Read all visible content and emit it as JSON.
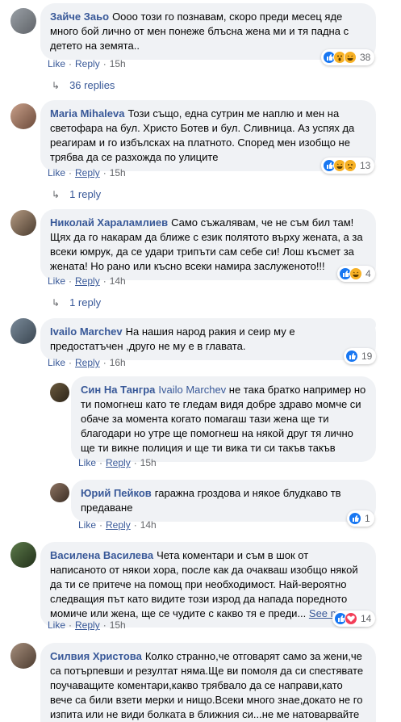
{
  "labels": {
    "like": "Like",
    "reply": "Reply",
    "see_more": "See more"
  },
  "colors": {
    "link": "#385898",
    "bubble": "#f0f2f5",
    "meta": "#65676b",
    "like": "#1877f2",
    "haha": "#f7b125",
    "love": "#f33e58"
  },
  "comments": [
    {
      "author": "Зайче Заьо",
      "text": "Оооо този го познавам, скоро преди месец яде много бой лично от мен понеже блъсна жена ми и тя падна с детето на земята..",
      "time": "15h",
      "reactions": [
        "like",
        "wow",
        "haha"
      ],
      "reaction_count": "38",
      "replies_label": "36 replies"
    },
    {
      "author": "Maria Mihaleva",
      "text": "Този също, една сутрин ме наплю и мен на светофара на бул. Христо Ботев и бул. Сливница. Аз успях да реагирам и го избълсках на платното. Според мен изобщо не трябва да се разхожда по улиците",
      "time": "15h",
      "reactions": [
        "like",
        "haha",
        "sad"
      ],
      "reaction_count": "13",
      "replies_label": "1 reply"
    },
    {
      "author": "Николай Хараламлиев",
      "text": "Само съжалявам, че не съм бил там! Щях да го накарам да ближе с език полятото върху жената, а за всеки юмрук, да се удари трипъти сам себе си! Лош късмет за жената! Но рано или късно всеки намира заслуженото!!!",
      "time": "14h",
      "reactions": [
        "like",
        "haha"
      ],
      "reaction_count": "4",
      "replies_label": "1 reply"
    },
    {
      "author": "Ivailo Marchev",
      "text": "На нашия народ ракия и сеир му е предостатъчен ,друго не му е в главата.",
      "time": "16h",
      "reactions": [
        "like"
      ],
      "reaction_count": "19"
    },
    {
      "author": "Син На Тангра",
      "mention": "Ivailo Marchev",
      "text": "не така братко например но ти помогнеш като те гледам видя добре здраво момче си обаче за момента когато помагаш тази жена ще ти благодари но утре ще помогнеш на някой друг тя лично ще ти викне полиция и ще ти вика ти си такъв такъв",
      "time": "15h"
    },
    {
      "author": "Юрий Пейков",
      "text": "гаражна гроздова и някое блудкаво тв предаване",
      "time": "14h",
      "reactions": [
        "like"
      ],
      "reaction_count": "1"
    },
    {
      "author": "Василена Василева",
      "text": "Чета коментари и съм в шок от написаното от някои хора, после как да очакваш изобщо някой да ти се притече на помощ при необходимост. Най-вероятно следващия път като видите този изрод да напада поредното момиче или жена, ще се чудите с какво тя е преди...",
      "time": "15h",
      "reactions": [
        "like",
        "love"
      ],
      "reaction_count": "14"
    },
    {
      "author": "Силвия Христова",
      "text": "Колко странно,че отговарят само за жени,че са потърпевши и резултат няма.Ще ви помоля да си спестявате поучаващите коментари,какво трябвало да се направи,като вече са били взети мерки и нищо.Всеки много знае,докато не го изпита или не види болката в ближния си...не ме натоварвайте излишно"
    }
  ]
}
